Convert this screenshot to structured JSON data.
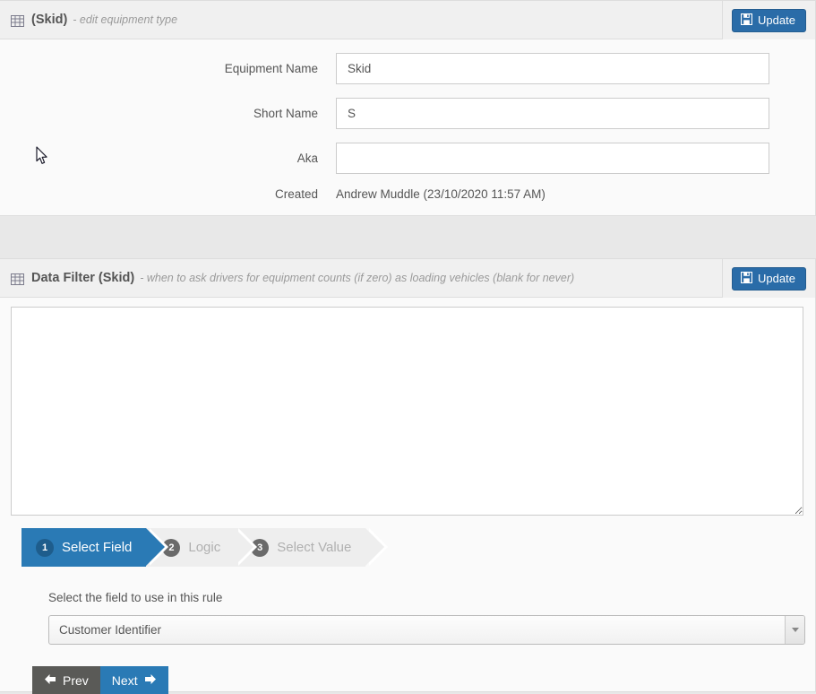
{
  "equipment_panel": {
    "icon": "grid-table-icon",
    "title": "(Skid)",
    "subtitle": "- edit equipment type",
    "update_label": "Update",
    "update_icon": "save-floppy-icon",
    "fields": [
      {
        "label": "Equipment Name",
        "value": "Skid",
        "placeholder": ""
      },
      {
        "label": "Short Name",
        "value": "S",
        "placeholder": ""
      },
      {
        "label": "Aka",
        "value": "",
        "placeholder": ""
      }
    ],
    "created_label": "Created",
    "created_value": "Andrew Muddle (23/10/2020 11:57 AM)"
  },
  "datafilter_panel": {
    "icon": "grid-table-icon",
    "title": "Data Filter (Skid)",
    "subtitle": "- when to ask drivers for equipment counts (if zero) as loading vehicles (blank for never)",
    "update_label": "Update",
    "update_icon": "save-floppy-icon",
    "textarea_value": "",
    "textarea_placeholder": "",
    "wizard": {
      "steps": [
        {
          "num": "1",
          "label": "Select Field",
          "active": true
        },
        {
          "num": "2",
          "label": "Logic",
          "active": false
        },
        {
          "num": "3",
          "label": "Select Value",
          "active": false
        }
      ]
    },
    "field_help": "Select the field to use in this rule",
    "select_value": "Customer Identifier",
    "select_caret_icon": "chevron-down-icon",
    "prev_label": "Prev",
    "prev_icon": "arrow-left-icon",
    "next_label": "Next",
    "next_icon": "arrow-right-icon"
  },
  "colors": {
    "accent_blue": "#2a7ab5",
    "button_blue": "#2a6ca8",
    "prev_gray": "#5a5a57",
    "step_inactive": "#eeeeee",
    "page_bg": "#e8e8e8",
    "panel_bg": "#fafafa"
  }
}
